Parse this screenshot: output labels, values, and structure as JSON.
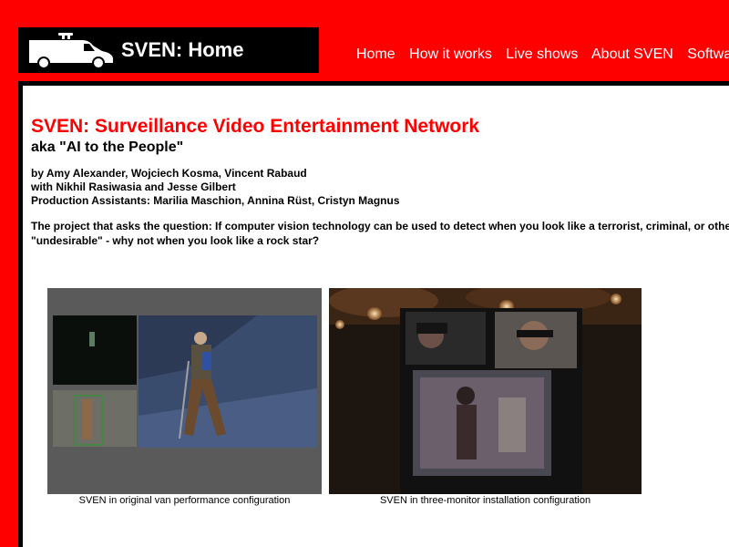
{
  "header": {
    "logo_title": "SVEN: Home"
  },
  "nav": {
    "items": [
      "Home",
      "How it works",
      "Live shows",
      "About SVEN",
      "Software"
    ]
  },
  "main": {
    "title": "SVEN: Surveillance Video Entertainment Network",
    "subtitle": "aka \"AI to the People\"",
    "credits": [
      "by Amy Alexander, Wojciech Kosma, Vincent Rabaud",
      "with Nikhil Rasiwasia and Jesse Gilbert",
      "Production Assistants: Marilia Maschion, Annina Rüst, Cristyn Magnus"
    ],
    "intro_lines": [
      "The project that asks the question: If computer vision technology can be used to detect when you look like a terrorist, criminal, or other",
      "\"undesirable\" - why not when you look like a rock star?"
    ],
    "figures": [
      {
        "caption": "SVEN in original van performance configuration"
      },
      {
        "caption": "SVEN in three-monitor installation configuration"
      }
    ]
  },
  "colors": {
    "background": "#ff0000",
    "title": "#ff0000",
    "logo_box": "#000000",
    "content": "#ffffff"
  }
}
